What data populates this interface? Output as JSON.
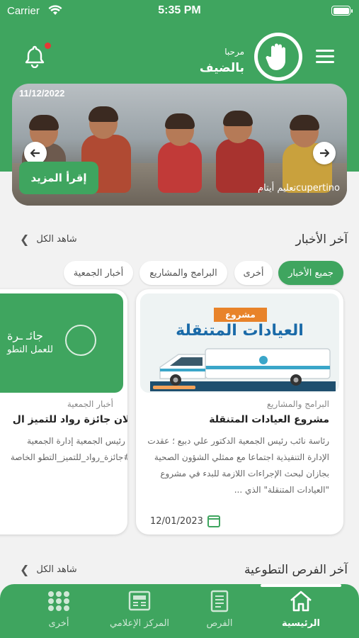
{
  "status_bar": {
    "carrier": "Carrier",
    "time": "5:35 PM"
  },
  "header": {
    "greeting": "مرحبا",
    "user_name": "بالضيف"
  },
  "banner": {
    "date": "11/12/2022",
    "read_more_label": "إقرأ المزيد",
    "caption": "تعليم أيتامcupertino"
  },
  "news": {
    "title": "آخر الأخبار",
    "see_all": "شاهد الكل",
    "tabs": [
      {
        "label": "جميع الأخبار",
        "active": true
      },
      {
        "label": "أخرى"
      },
      {
        "label": "البرامج والمشاريع"
      },
      {
        "label": "أخبار الجمعية"
      }
    ],
    "cards": [
      {
        "image_banner_small": "مشروع",
        "image_banner_big": "العيادات المتنقلة",
        "category": "البرامج والمشاريع",
        "title": "مشروع العيادات المتنقلة",
        "body": "رئاسة نائب رئيس الجمعية الدكتور علي دبيع ؛ عقدت الإدارة التنفيذية اجتماعا مع ممثلي الشؤون الصحية بجازان لبحث الإجراءات اللازمة للبدء في مشروع \"العيادات المتنقلة\" الذي ...",
        "date": "12/01/2023"
      },
      {
        "image_text_1": "جائـ ـرة",
        "image_text_2": "للعمل التطو",
        "category": "أخبار الجمعية",
        "title": "اعلان جائزة رواد للتميز ال",
        "body": "برئاسة نائب رئيس الجمعية إدارة الجمعية تجتمع مع أ #جائزة_رواد_للتميز_التطو الخاصة بالجائزة ."
      }
    ]
  },
  "volunteer": {
    "title": "آخر الفرص التطوعية",
    "see_all": "شاهد الكل"
  },
  "bottom_nav": [
    {
      "label": "الرئيسية",
      "icon": "home-icon",
      "active": true
    },
    {
      "label": "الفرص",
      "icon": "document-icon"
    },
    {
      "label": "المركز الإعلامي",
      "icon": "newspaper-icon"
    },
    {
      "label": "أخرى",
      "icon": "grid-dots-icon"
    }
  ],
  "colors": {
    "primary": "#3fa55f",
    "notification": "#e53935"
  }
}
